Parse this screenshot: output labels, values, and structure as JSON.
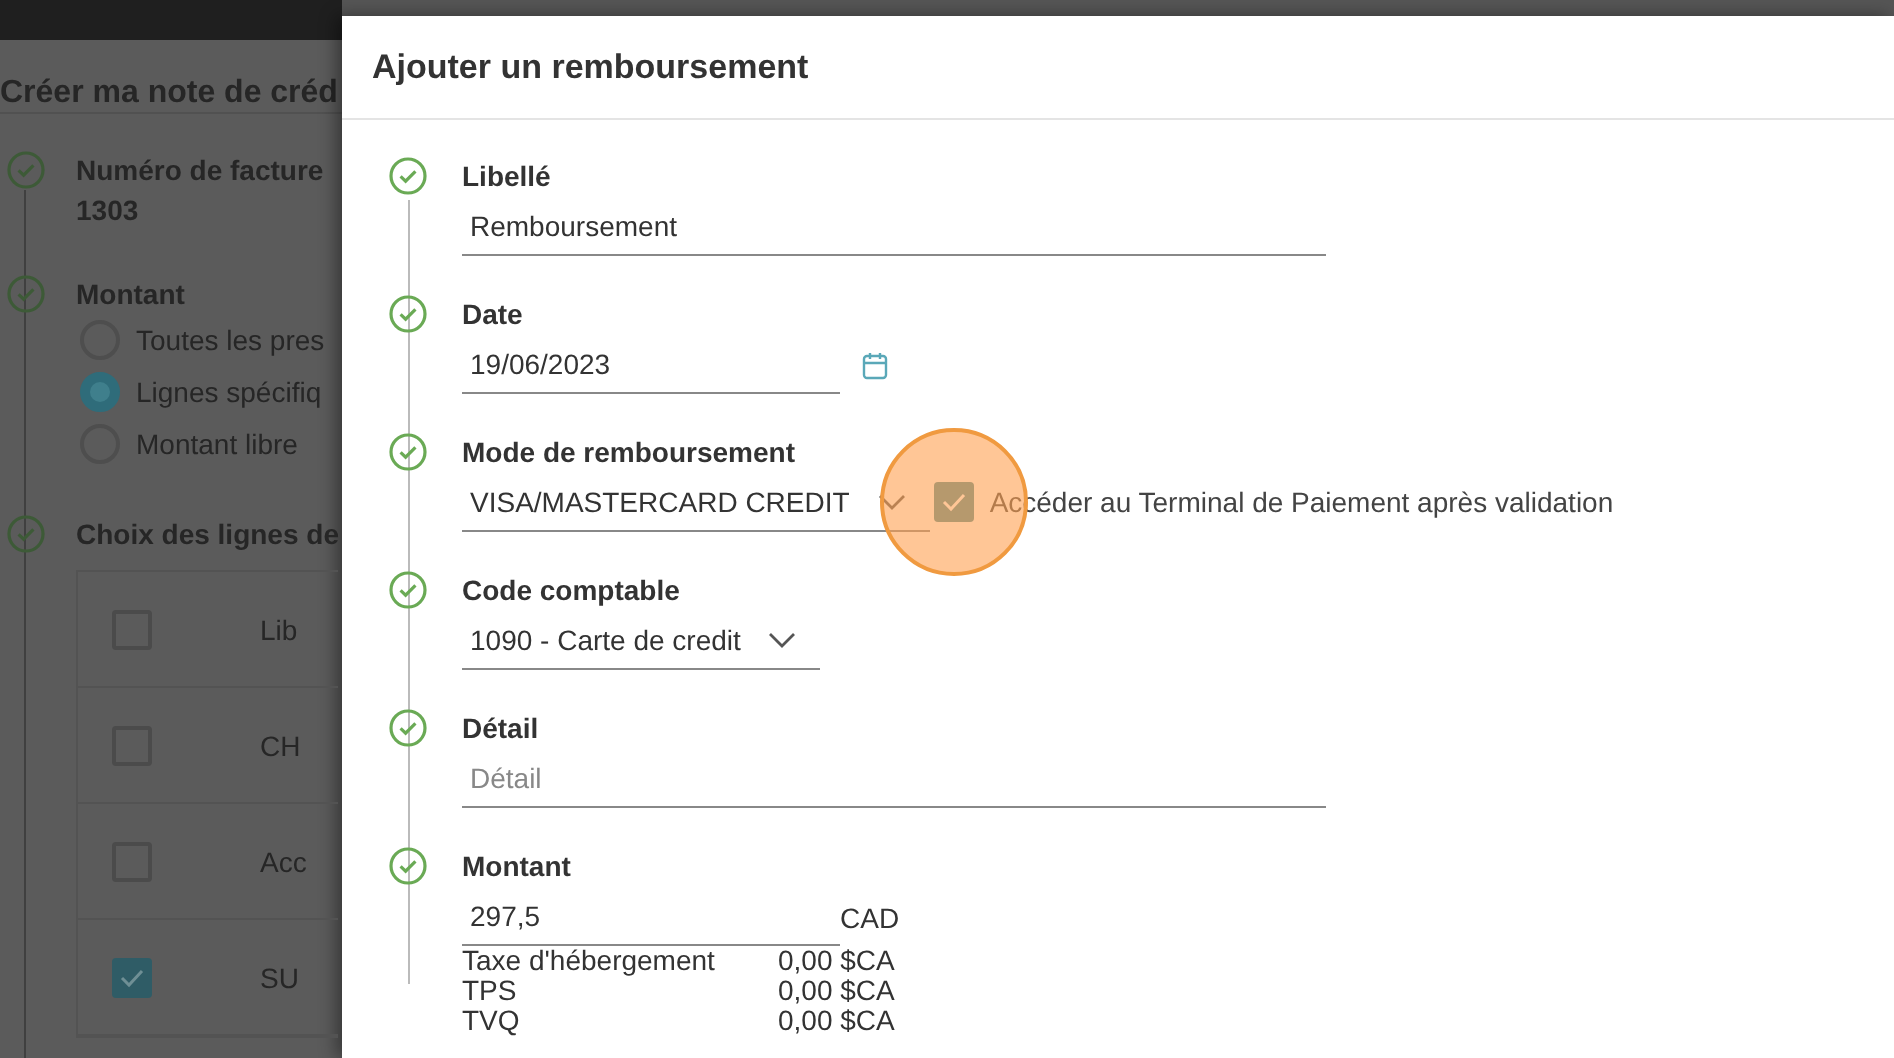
{
  "page": {
    "title": "Créer ma note de créd",
    "steps": [
      {
        "kind": "value",
        "label": "Numéro de facture",
        "value": "1303"
      },
      {
        "kind": "radios",
        "label": "Montant",
        "options": [
          {
            "label": "Toutes les pres",
            "selected": false
          },
          {
            "label": "Lignes spécifiq",
            "selected": true
          },
          {
            "label": "Montant libre",
            "selected": false
          }
        ]
      },
      {
        "kind": "table",
        "label": "Choix des lignes de",
        "rows": [
          {
            "text": "Lib",
            "checked": false
          },
          {
            "text": "CH",
            "checked": false
          },
          {
            "text": "Acc",
            "checked": false
          },
          {
            "text": "SU",
            "checked": true
          }
        ]
      }
    ]
  },
  "dialog": {
    "title": "Ajouter un remboursement",
    "fields": [
      {
        "kind": "text",
        "label": "Libellé",
        "value": "Remboursement"
      },
      {
        "kind": "date",
        "label": "Date",
        "value": "19/06/2023"
      },
      {
        "kind": "select",
        "label": "Mode de remboursement",
        "value": "VISA/MASTERCARD CREDIT",
        "checkbox": {
          "label": "Accéder au Terminal de Paiement après validation",
          "checked": true,
          "highlighted": true
        }
      },
      {
        "kind": "select",
        "label": "Code comptable",
        "value": "1090 - Carte de credit"
      },
      {
        "kind": "text",
        "label": "Détail",
        "placeholder": "Détail"
      },
      {
        "kind": "amount",
        "label": "Montant",
        "value": "297,5",
        "currency": "CAD",
        "taxes": [
          {
            "name": "Taxe d'hébergement",
            "amount": "0,00 $CA"
          },
          {
            "name": "TPS",
            "amount": "0,00 $CA"
          },
          {
            "name": "TVQ",
            "amount": "0,00 $CA"
          }
        ]
      }
    ]
  }
}
